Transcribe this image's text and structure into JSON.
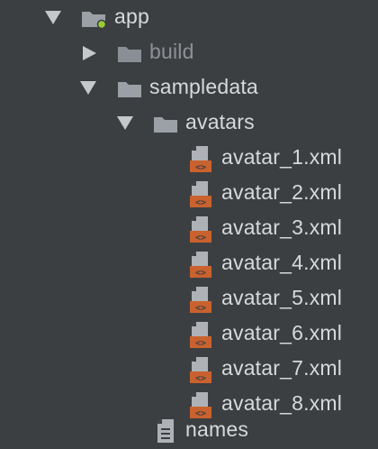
{
  "tree": {
    "app": {
      "label": "app",
      "icon": "module-folder-icon"
    },
    "build": {
      "label": "build",
      "icon": "folder-icon"
    },
    "sampledata": {
      "label": "sampledata",
      "icon": "folder-icon"
    },
    "avatars": {
      "label": "avatars",
      "icon": "folder-icon"
    },
    "files": [
      {
        "label": "avatar_1.xml",
        "icon": "xml-file-icon"
      },
      {
        "label": "avatar_2.xml",
        "icon": "xml-file-icon"
      },
      {
        "label": "avatar_3.xml",
        "icon": "xml-file-icon"
      },
      {
        "label": "avatar_4.xml",
        "icon": "xml-file-icon"
      },
      {
        "label": "avatar_5.xml",
        "icon": "xml-file-icon"
      },
      {
        "label": "avatar_6.xml",
        "icon": "xml-file-icon"
      },
      {
        "label": "avatar_7.xml",
        "icon": "xml-file-icon"
      },
      {
        "label": "avatar_8.xml",
        "icon": "xml-file-icon"
      }
    ],
    "names": {
      "label": "names",
      "icon": "text-file-icon"
    }
  },
  "colors": {
    "background": "#3c3f41",
    "text": "#d7d9dc",
    "dim_text": "#8e9297",
    "folder": "#9aa0a6",
    "xml_badge": "#c9622f",
    "module_dot": "#9acd32"
  }
}
